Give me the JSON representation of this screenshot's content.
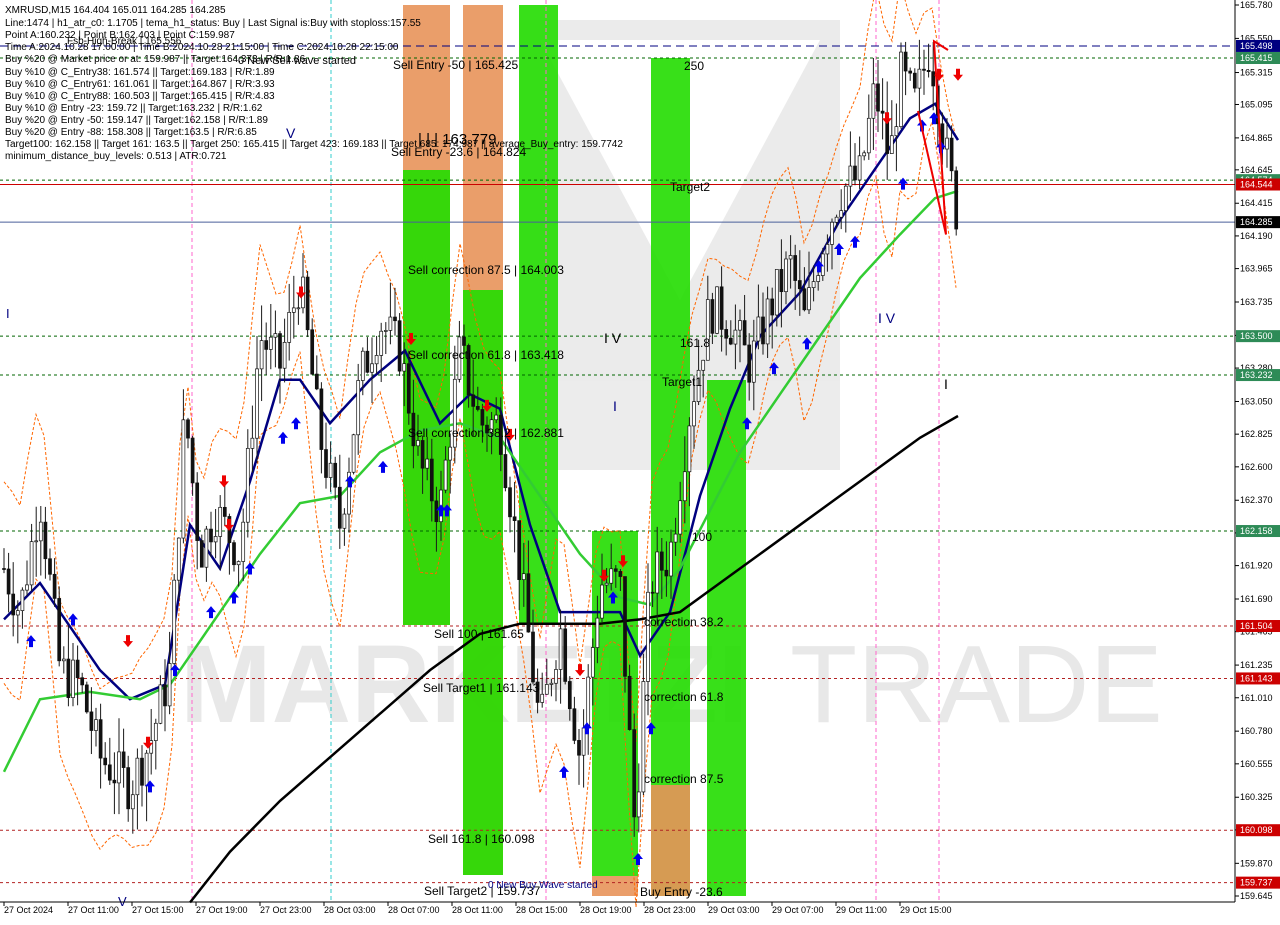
{
  "info_lines": [
    "XMRUSD,M15  164.404 165.011 164.285 164.285",
    "Line:1474 | h1_atr_c0: 1.1705 | tema_h1_status: Buy | Last Signal is:Buy with stoploss:157.55",
    "Point A:160.232 | Point B:162.403 | Point C:159.987",
    "Time A:2024.10.28 17:00:00 | Time B:2024.10.28 21:15:00 | Time C:2024.10.28 22:15:00",
    "Buy %20 @ Market price or at: 159.987 || Target:164.373 | R/R:1.86",
    "Buy %10 @ C_Entry38: 161.574 || Target:169.183 | R/R:1.89",
    "Buy %10 @ C_Entry61: 161.061 || Target:164.867 | R/R:3.93",
    "Buy %10 @ C_Entry88: 160.503 || Target:165.415 | R/R:4.83",
    "Buy %10 @ Entry -23: 159.72 || Target:163.232 | R/R:1.62",
    "Buy %20 @ Entry -50: 159.147 || Target:162.158 | R/R:1.89",
    "Buy %20 @ Entry -88: 158.308 || Target:163.5 | R/R:6.85",
    "Target100: 162.158 || Target 161: 163.5 || Target 250: 165.415 || Target 423: 169.183 || Target 685: 174.987 || average_Buy_entry: 159.7742",
    "minimum_distance_buy_levels: 0.513 | ATR:0.721"
  ],
  "overlay_texts": {
    "high_break": "Fsb-High-Break | 165.556",
    "new_sell_wave": "0 New Sell wave started",
    "new_buy_wave": "0 New Buy Wave started",
    "big_level": "| | | 163.779"
  },
  "zone_labels": [
    {
      "text": "Sell Entry -50 | 165.425",
      "color": "#1a6b1a"
    },
    {
      "text": "Sell Entry -23.6 | 164.824",
      "color": "#1a6b1a"
    },
    {
      "text": "Sell correction 87.5 | 164.003",
      "color": "#1a6b1a"
    },
    {
      "text": "Sell correction 61.8 | 163.418",
      "color": "#1a6b1a"
    },
    {
      "text": "Sell correction 38.2 | 162.881",
      "color": "#1a6b1a"
    },
    {
      "text": "Sell 100 | 161.65",
      "color": "#b22222"
    },
    {
      "text": "Sell Target1 | 161.143",
      "color": "#b22222"
    },
    {
      "text": "Sell 161.8 | 160.098",
      "color": "#b22222"
    },
    {
      "text": "Sell Target2 | 159.737",
      "color": "#b22222"
    },
    {
      "text": "correction 38.2",
      "color": "#0000cc"
    },
    {
      "text": "correction 61.8",
      "color": "#0000cc"
    },
    {
      "text": "correction 87.5",
      "color": "#0000cc"
    },
    {
      "text": "Buy Entry -23.6",
      "color": "#0000cc"
    },
    {
      "text": "250",
      "color": "#1a6b1a"
    },
    {
      "text": "Target2",
      "color": "#1a6b1a"
    },
    {
      "text": "161.8",
      "color": "#1a6b1a"
    },
    {
      "text": "Target1",
      "color": "#1a6b1a"
    },
    {
      "text": "100",
      "color": "#1a6b1a"
    }
  ],
  "wave_marks": [
    "V",
    "I",
    "I V",
    "I",
    "I V",
    "I",
    "V"
  ],
  "watermark": {
    "text1": "MARKETZI",
    "text2": "TRADE"
  },
  "colors": {
    "bull": "#1a1a1a",
    "bear": "#1a1a1a",
    "tema": "#000080",
    "ma_green": "#33cc33",
    "ma_black": "#000000",
    "zone_green": "#22dd00",
    "zone_orange": "#e8945a",
    "red_line": "#cc0000",
    "blue_line": "#000080",
    "green_dashed": "#006400",
    "red_dashed": "#b22222"
  },
  "chart_data": {
    "type": "candlestick",
    "symbol": "XMRUSD",
    "timeframe": "M15",
    "ylim": [
      159.645,
      165.78
    ],
    "y_ticks": [
      165.78,
      165.55,
      165.315,
      165.095,
      164.865,
      164.645,
      164.415,
      164.19,
      163.965,
      163.735,
      163.505,
      163.28,
      163.05,
      162.825,
      162.6,
      162.37,
      162.145,
      161.92,
      161.69,
      161.465,
      161.235,
      161.01,
      160.78,
      160.555,
      160.325,
      160.1,
      159.87,
      159.645
    ],
    "x_ticks": [
      "27 Oct 2024",
      "27 Oct 11:00",
      "27 Oct 15:00",
      "27 Oct 19:00",
      "27 Oct 23:00",
      "28 Oct 03:00",
      "28 Oct 07:00",
      "28 Oct 11:00",
      "28 Oct 15:00",
      "28 Oct 19:00",
      "28 Oct 23:00",
      "29 Oct 03:00",
      "29 Oct 07:00",
      "29 Oct 11:00",
      "29 Oct 15:00"
    ],
    "price_labels": [
      {
        "value": 165.498,
        "bg": "#000080"
      },
      {
        "value": 165.415,
        "bg": "#2e8b57"
      },
      {
        "value": 164.574,
        "bg": "#2e8b57"
      },
      {
        "value": 164.544,
        "bg": "#cc0000"
      },
      {
        "value": 164.285,
        "bg": "#000000"
      },
      {
        "value": 163.5,
        "bg": "#2e8b57"
      },
      {
        "value": 163.232,
        "bg": "#2e8b57"
      },
      {
        "value": 162.158,
        "bg": "#2e8b57"
      },
      {
        "value": 161.504,
        "bg": "#cc0000"
      },
      {
        "value": 161.143,
        "bg": "#cc0000"
      },
      {
        "value": 160.098,
        "bg": "#cc0000"
      },
      {
        "value": 159.737,
        "bg": "#cc0000"
      }
    ],
    "horizontal_levels": [
      {
        "value": 165.498,
        "style": "blue-dashed"
      },
      {
        "value": 165.415,
        "style": "green-dashed"
      },
      {
        "value": 164.574,
        "style": "green-dashed"
      },
      {
        "value": 164.544,
        "style": "red-solid"
      },
      {
        "value": 164.285,
        "style": "gray-solid"
      },
      {
        "value": 163.5,
        "style": "green-dashed"
      },
      {
        "value": 163.232,
        "style": "green-dashed"
      },
      {
        "value": 162.158,
        "style": "green-dashed"
      },
      {
        "value": 161.504,
        "style": "red-dashed"
      },
      {
        "value": 161.143,
        "style": "red-dashed"
      },
      {
        "value": 160.098,
        "style": "red-dashed"
      },
      {
        "value": 159.737,
        "style": "red-dashed"
      }
    ],
    "last_price": 164.285,
    "ohlc_last": {
      "open": 164.404,
      "high": 165.011,
      "low": 164.285,
      "close": 164.285
    }
  }
}
